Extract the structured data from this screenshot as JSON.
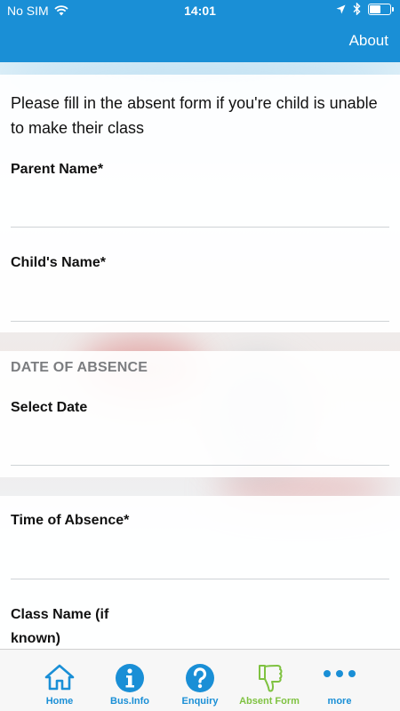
{
  "status": {
    "carrier": "No SIM",
    "time": "14:01",
    "battery_level": 0.55
  },
  "navbar": {
    "right_label": "About"
  },
  "form": {
    "intro": "Please fill in the absent form if you're child is unable to make their class",
    "parent_name_label": "Parent Name*",
    "child_name_label": "Child's Name*",
    "date_heading": "DATE OF ABSENCE",
    "select_date_label": "Select Date",
    "time_label": "Time of Absence*",
    "class_name_label_line1": "Class Name (if",
    "class_name_label_line2": "known)"
  },
  "tabs": [
    {
      "label": "Home",
      "icon": "home-icon"
    },
    {
      "label": "Bus.Info",
      "icon": "info-icon"
    },
    {
      "label": "Enquiry",
      "icon": "question-icon"
    },
    {
      "label": "Absent Form",
      "icon": "thumbs-down-icon",
      "active": true
    },
    {
      "label": "more",
      "icon": "more-dots-icon"
    }
  ],
  "colors": {
    "brand": "#1a8fd6",
    "active_tab": "#7fc241"
  }
}
